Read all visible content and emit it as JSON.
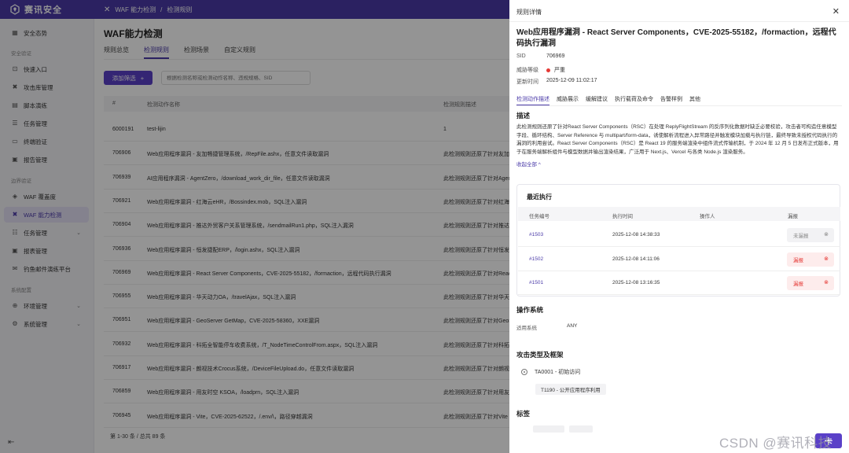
{
  "topbar": {
    "logo": "赛讯安全",
    "breadcrumb": [
      "WAF 能力检测",
      "检测规则"
    ]
  },
  "sidebar": {
    "items": [
      {
        "label": "安全态势",
        "icon": "grid-icon"
      },
      {
        "label": "快速入口",
        "icon": "entry-icon"
      },
      {
        "label": "攻击库管理",
        "icon": "cross-icon"
      },
      {
        "label": "脚本演练",
        "icon": "script-icon"
      },
      {
        "label": "任务管理",
        "icon": "list-icon"
      },
      {
        "label": "终端验证",
        "icon": "terminal-icon"
      },
      {
        "label": "报告管理",
        "icon": "report-icon"
      },
      {
        "label": "WAF 覆盖度",
        "icon": "shield-icon"
      },
      {
        "label": "WAF 能力检测",
        "icon": "cross-icon"
      },
      {
        "label": "任务管理",
        "icon": "list-icon"
      },
      {
        "label": "报表管理",
        "icon": "report-icon"
      },
      {
        "label": "钓鱼邮件演练平台",
        "icon": "mail-icon"
      },
      {
        "label": "环境管理",
        "icon": "env-icon"
      },
      {
        "label": "系统管理",
        "icon": "gear-icon"
      }
    ],
    "groups": [
      "安全验证",
      "边界验证",
      "系统配置"
    ]
  },
  "main": {
    "title": "WAF能力检测",
    "tabs": [
      "规则总览",
      "检测规则",
      "检测场景",
      "自定义规则"
    ],
    "add_button": "添加筛选",
    "search_placeholder": "根据检测名称或检测动作名称、违规规格、SID",
    "columns": [
      "#",
      "检测动作名称",
      "检测规则描述"
    ],
    "rows": [
      {
        "id": "6000191",
        "name": "test-lijin",
        "desc": "1"
      },
      {
        "id": "706906",
        "name": "Web应用程序漏洞 - 友加畅捷管理系统，/RepFile.ashx，任意文件读取漏洞",
        "desc": "此检测规则还原了针对友加"
      },
      {
        "id": "706939",
        "name": "AI应用程序漏洞 - AgentZero，/download_work_dir_file，任意文件读取漏洞",
        "desc": "此检测规则还原了针对Agent"
      },
      {
        "id": "706921",
        "name": "Web应用程序漏洞 - 红海云eHR，/Bossindex.mob，SQL注入漏洞",
        "desc": "此检测规则还原了针对红海云"
      },
      {
        "id": "706904",
        "name": "Web应用程序漏洞 - 推达外贸客户关系管理系统，/sendmailRun1.php，SQL注入漏洞",
        "desc": "此检测规则还原了针对推达外"
      },
      {
        "id": "706936",
        "name": "Web应用程序漏洞 - 恒发捷配ERP，/login.ashx，SQL注入漏洞",
        "desc": "此检测规则还原了针对恒发捷"
      },
      {
        "id": "706969",
        "name": "Web应用程序漏洞 - React Server Components，CVE-2025-55182，/formaction，远程代码执行漏洞",
        "desc": "此检测规则还原了针对React"
      },
      {
        "id": "706955",
        "name": "Web应用程序漏洞 - 华天动力OA，/travelAjax，SQL注入漏洞",
        "desc": "此检测规则还原了针对华天动"
      },
      {
        "id": "706951",
        "name": "Web应用程序漏洞 - GeoServer GetMap，CVE-2025-58360，XXE漏洞",
        "desc": "此检测规则还原了针对GeoS"
      },
      {
        "id": "706932",
        "name": "Web应用程序漏洞 - 科拓全智能停车收费系统，/T_NodeTimeControlFrom.aspx，SQL注入漏洞",
        "desc": "此检测规则还原了针对科拓全"
      },
      {
        "id": "706917",
        "name": "Web应用程序漏洞 - 朗视技术Crocus系统，/DeviceFileUpload.do，任意文件读取漏洞",
        "desc": "此检测规则还原了针对朗视技"
      },
      {
        "id": "706859",
        "name": "Web应用程序漏洞 - 用友时空 KSOA，/loadprn，SQL注入漏洞",
        "desc": "此检测规则还原了针对用友时"
      },
      {
        "id": "706945",
        "name": "Web应用程序漏洞 - Vite，CVE-2025-62522，/.env/\\，路径穿越漏洞",
        "desc": "此检测规则还原了针对Vite 9"
      }
    ],
    "footer": "第 1-30 条 / 总共 89 条"
  },
  "drawer": {
    "header": "规则详情",
    "title": "Web应用程序漏洞 - React Server Components，CVE-2025-55182，/formaction，远程代码执行漏洞",
    "sid_label": "SID",
    "sid": "706969",
    "threat_label": "威胁等级",
    "threat": "严重",
    "updated_label": "更新时间",
    "updated": "2025-12-09 11:02:17",
    "tabs": [
      "检测动作描述",
      "威胁展示",
      "缓解建议",
      "执行载荷及命令",
      "告警样例",
      "其他"
    ],
    "desc_title": "描述",
    "description": "此检测规则还原了针对React Server Components（RSC）在处理 ReplyFlightStream 的反序列化数据时缺乏必要校验，攻击者可构造任意模型字段、循环结构、Server Reference 与 multipart/form-data，诱使解析流程进入异常路径并触发模块加载与执行链，最终导致未授权代码执行的漏洞的利用尝试。React Server Components（RSC）是 React 19 的服务端渲染中组件流式传输机制，于 2024 年 12 月 5 日发布正式版本，用于在服务端解析组件与模型数据并输出渲染结果，广泛用于 Next.js、Vercel 与各类 Node.js 渲染服务。",
    "collapse": "收起全部 ^",
    "recent_exec": {
      "title": "最近执行",
      "columns": [
        "任务编号",
        "执行时间",
        "操作人",
        "漏报"
      ],
      "rows": [
        {
          "task": "#1503",
          "time": "2025-12-08 14:38:33",
          "operator": "",
          "status": "未漏报",
          "state": "no"
        },
        {
          "task": "#1502",
          "time": "2025-12-08 14:11:06",
          "operator": "",
          "status": "漏报",
          "state": "yes"
        },
        {
          "task": "#1501",
          "time": "2025-12-08 13:16:35",
          "operator": "",
          "status": "漏报",
          "state": "yes"
        }
      ]
    },
    "os_title": "操作系统",
    "os_label": "适用系统",
    "os_value": "ANY",
    "attack_title": "攻击类型及框架",
    "tactic": "TA0001 - 初始访问",
    "technique": "T1190 - 公开应用程序利用",
    "tags_title": "标签",
    "fab": "卡"
  },
  "watermark": "CSDN @赛讯科技"
}
